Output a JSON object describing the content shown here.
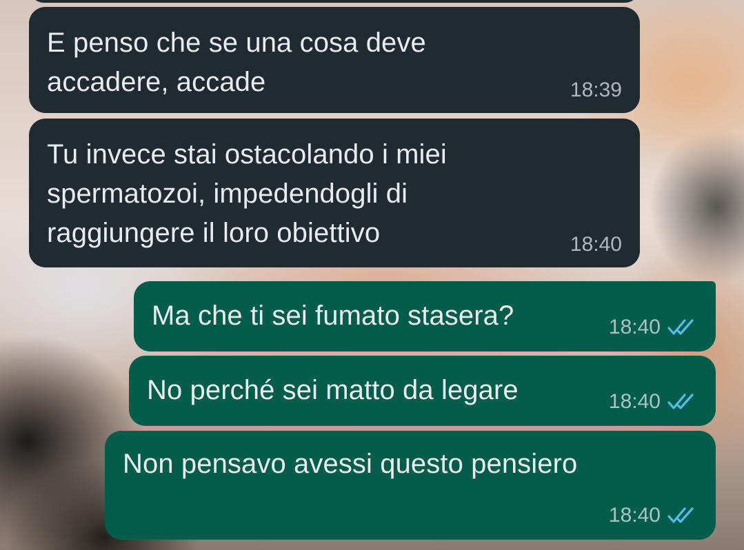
{
  "conversation": {
    "messages": [
      {
        "direction": "incoming",
        "text": "E penso che se una cosa deve\naccadere, accade",
        "time": "18:39"
      },
      {
        "direction": "incoming",
        "text": "Tu invece stai ostacolando i miei\nspermatozoi, impedendogli di\nraggiungere il loro obiettivo",
        "time": "18:40"
      },
      {
        "direction": "outgoing",
        "text": "Ma che ti sei fumato stasera?",
        "time": "18:40",
        "status_icon": "double-check-read-icon"
      },
      {
        "direction": "outgoing",
        "text": "No perché sei matto da legare",
        "time": "18:40",
        "status_icon": "double-check-read-icon"
      },
      {
        "direction": "outgoing",
        "text": "Non pensavo avessi questo pensiero",
        "time": "18:40",
        "status_icon": "double-check-read-icon"
      }
    ]
  },
  "colors": {
    "incoming_bubble": "#1f2a31",
    "outgoing_bubble": "#045c4b",
    "text": "#e9edef",
    "read_tick": "#53bdeb"
  }
}
